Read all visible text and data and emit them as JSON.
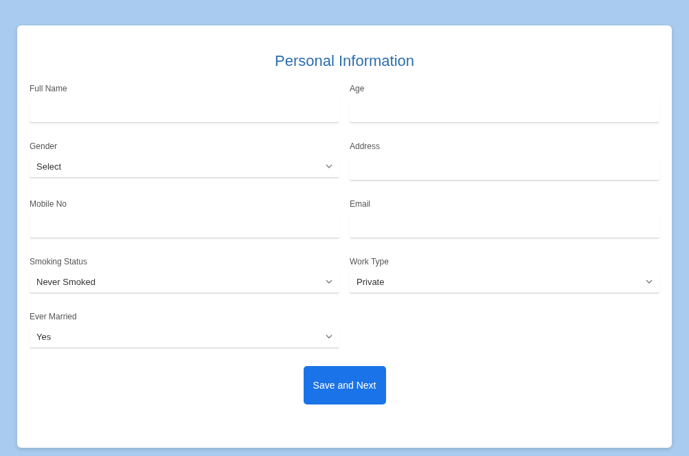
{
  "form": {
    "title": "Personal Information",
    "fields": [
      {
        "kind": "text",
        "label": "Full Name"
      },
      {
        "kind": "text",
        "label": "Age"
      },
      {
        "kind": "select",
        "label": "Gender",
        "value": "Select"
      },
      {
        "kind": "text",
        "label": "Address"
      },
      {
        "kind": "text",
        "label": "Mobile No"
      },
      {
        "kind": "text",
        "label": "Email"
      },
      {
        "kind": "select",
        "label": "Smoking Status",
        "value": "Never Smoked"
      },
      {
        "kind": "select",
        "label": "Work Type",
        "value": "Private"
      },
      {
        "kind": "select",
        "label": "Ever Married",
        "value": "Yes"
      }
    ],
    "submit": "Save and Next"
  }
}
